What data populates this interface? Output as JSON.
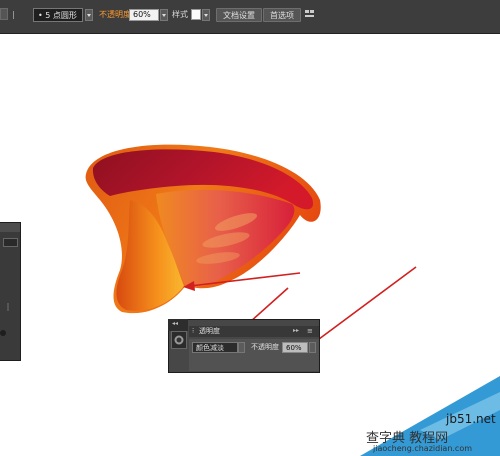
{
  "toolbar": {
    "shape_value": "5 点圆形",
    "opacity_label": "不透明度",
    "opacity_value": "60%",
    "style_label": "样式",
    "doc_setup_button": "文档设置",
    "preferences_button": "首选项"
  },
  "transparency_panel": {
    "title": "透明度",
    "blend_mode": "颜色减淡",
    "opacity_label": "不透明度",
    "opacity_value": "60%"
  },
  "watermark": {
    "site": "jb51.net",
    "brand": "查字典 教程网",
    "url": "jiaocheng.chazidian.com"
  },
  "colors": {
    "toolbar_bg": "#3d3d3d",
    "annotation_arrow": "#d21f1f",
    "accent_orange": "#ff9a2f",
    "watermark_blue": "#1e8fd0"
  }
}
